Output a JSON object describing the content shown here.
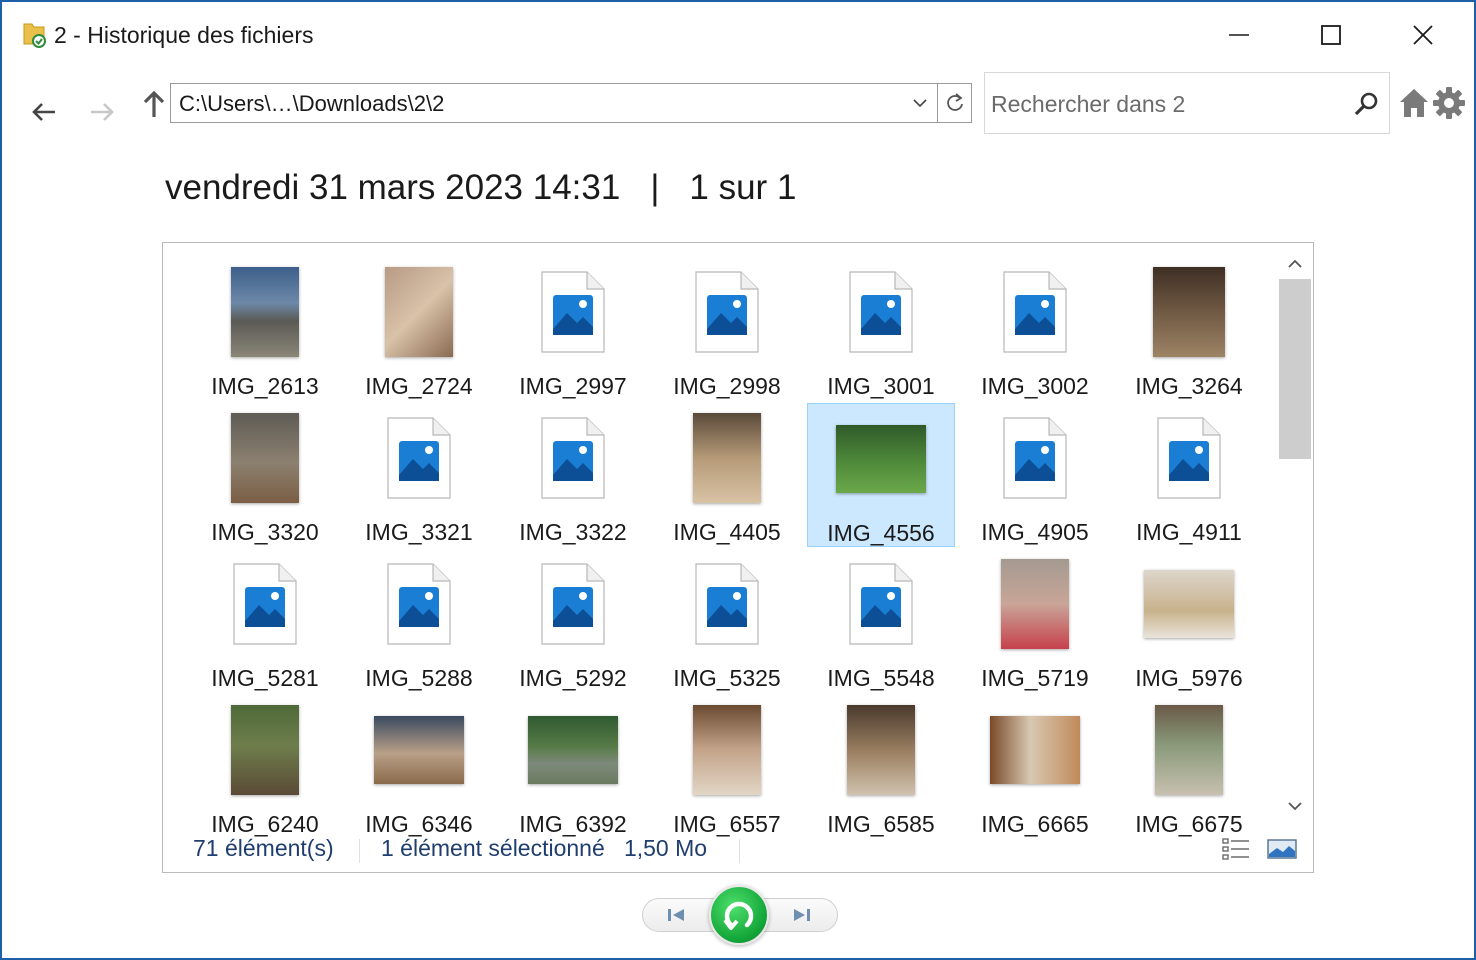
{
  "window": {
    "title": "2 - Historique des fichiers",
    "minimize_icon": "minimize-icon",
    "maximize_icon": "maximize-icon",
    "close_icon": "close-icon"
  },
  "toolbar": {
    "address": "C:\\Users\\…\\Downloads\\2\\2",
    "search_placeholder": "Rechercher dans 2",
    "icons": [
      "back-arrow-icon",
      "forward-arrow-icon",
      "up-arrow-icon",
      "chevron-down-icon",
      "refresh-icon",
      "search-icon",
      "home-icon",
      "gear-icon"
    ]
  },
  "header": {
    "date": "vendredi 31 mars 2023 14:31",
    "separator": "|",
    "position": "1 sur 1"
  },
  "files": [
    {
      "name": "IMG_2613",
      "kind": "photo"
    },
    {
      "name": "IMG_2724",
      "kind": "photo"
    },
    {
      "name": "IMG_2997",
      "kind": "generic"
    },
    {
      "name": "IMG_2998",
      "kind": "generic"
    },
    {
      "name": "IMG_3001",
      "kind": "generic"
    },
    {
      "name": "IMG_3002",
      "kind": "generic"
    },
    {
      "name": "IMG_3264",
      "kind": "photo"
    },
    {
      "name": "IMG_3320",
      "kind": "photo"
    },
    {
      "name": "IMG_3321",
      "kind": "generic"
    },
    {
      "name": "IMG_3322",
      "kind": "generic"
    },
    {
      "name": "IMG_4405",
      "kind": "photo"
    },
    {
      "name": "IMG_4556",
      "kind": "photo",
      "selected": true
    },
    {
      "name": "IMG_4905",
      "kind": "generic"
    },
    {
      "name": "IMG_4911",
      "kind": "generic"
    },
    {
      "name": "IMG_5281",
      "kind": "generic"
    },
    {
      "name": "IMG_5288",
      "kind": "generic"
    },
    {
      "name": "IMG_5292",
      "kind": "generic"
    },
    {
      "name": "IMG_5325",
      "kind": "generic"
    },
    {
      "name": "IMG_5548",
      "kind": "generic"
    },
    {
      "name": "IMG_5719",
      "kind": "photo"
    },
    {
      "name": "IMG_5976",
      "kind": "photo"
    },
    {
      "name": "IMG_6240",
      "kind": "photo"
    },
    {
      "name": "IMG_6346",
      "kind": "photo"
    },
    {
      "name": "IMG_6392",
      "kind": "photo"
    },
    {
      "name": "IMG_6557",
      "kind": "photo"
    },
    {
      "name": "IMG_6585",
      "kind": "photo"
    },
    {
      "name": "IMG_6665",
      "kind": "photo"
    },
    {
      "name": "IMG_6675",
      "kind": "photo"
    }
  ],
  "status": {
    "count": "71 élément(s)",
    "selection": "1 élément sélectionné",
    "size": "1,50 Mo"
  },
  "controls": {
    "icons": [
      "previous-version-icon",
      "restore-icon",
      "next-version-icon"
    ]
  },
  "colors": {
    "selection_bg": "#cce8ff",
    "selection_border": "#99d1ff",
    "restore_green": "#14a83a",
    "status_text": "#1f3e6e",
    "image_icon_blue": "#1a7fd4"
  }
}
